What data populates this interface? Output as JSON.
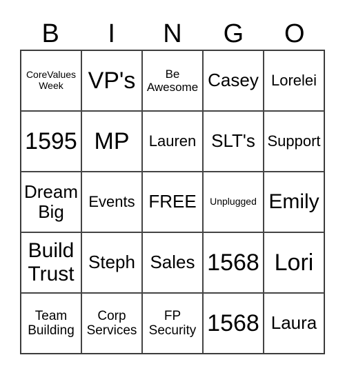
{
  "header": {
    "letters": [
      "B",
      "I",
      "N",
      "G",
      "O"
    ]
  },
  "grid": {
    "rows": [
      [
        {
          "text": "CoreValues\nWeek",
          "size": "xs"
        },
        {
          "text": "VP's",
          "size": "xxl"
        },
        {
          "text": "Be\nAwesome",
          "size": "sm-"
        },
        {
          "text": "Casey",
          "size": "lg"
        },
        {
          "text": "Lorelei",
          "size": "md"
        }
      ],
      [
        {
          "text": "1595",
          "size": "xxl"
        },
        {
          "text": "MP",
          "size": "xxl"
        },
        {
          "text": "Lauren",
          "size": "md"
        },
        {
          "text": "SLT's",
          "size": "lg"
        },
        {
          "text": "Support",
          "size": "md"
        }
      ],
      [
        {
          "text": "Dream\nBig",
          "size": "lg"
        },
        {
          "text": "Events",
          "size": "md"
        },
        {
          "text": "FREE",
          "size": "lg"
        },
        {
          "text": "Unplugged",
          "size": "xs"
        },
        {
          "text": "Emily",
          "size": "xl"
        }
      ],
      [
        {
          "text": "Build\nTrust",
          "size": "xl"
        },
        {
          "text": "Steph",
          "size": "lg"
        },
        {
          "text": "Sales",
          "size": "lg"
        },
        {
          "text": "1568",
          "size": "xxl"
        },
        {
          "text": "Lori",
          "size": "xxl"
        }
      ],
      [
        {
          "text": "Team\nBuilding",
          "size": "sm"
        },
        {
          "text": "Corp\nServices",
          "size": "sm"
        },
        {
          "text": "FP\nSecurity",
          "size": "sm"
        },
        {
          "text": "1568",
          "size": "xxl"
        },
        {
          "text": "Laura",
          "size": "lg"
        }
      ]
    ]
  }
}
